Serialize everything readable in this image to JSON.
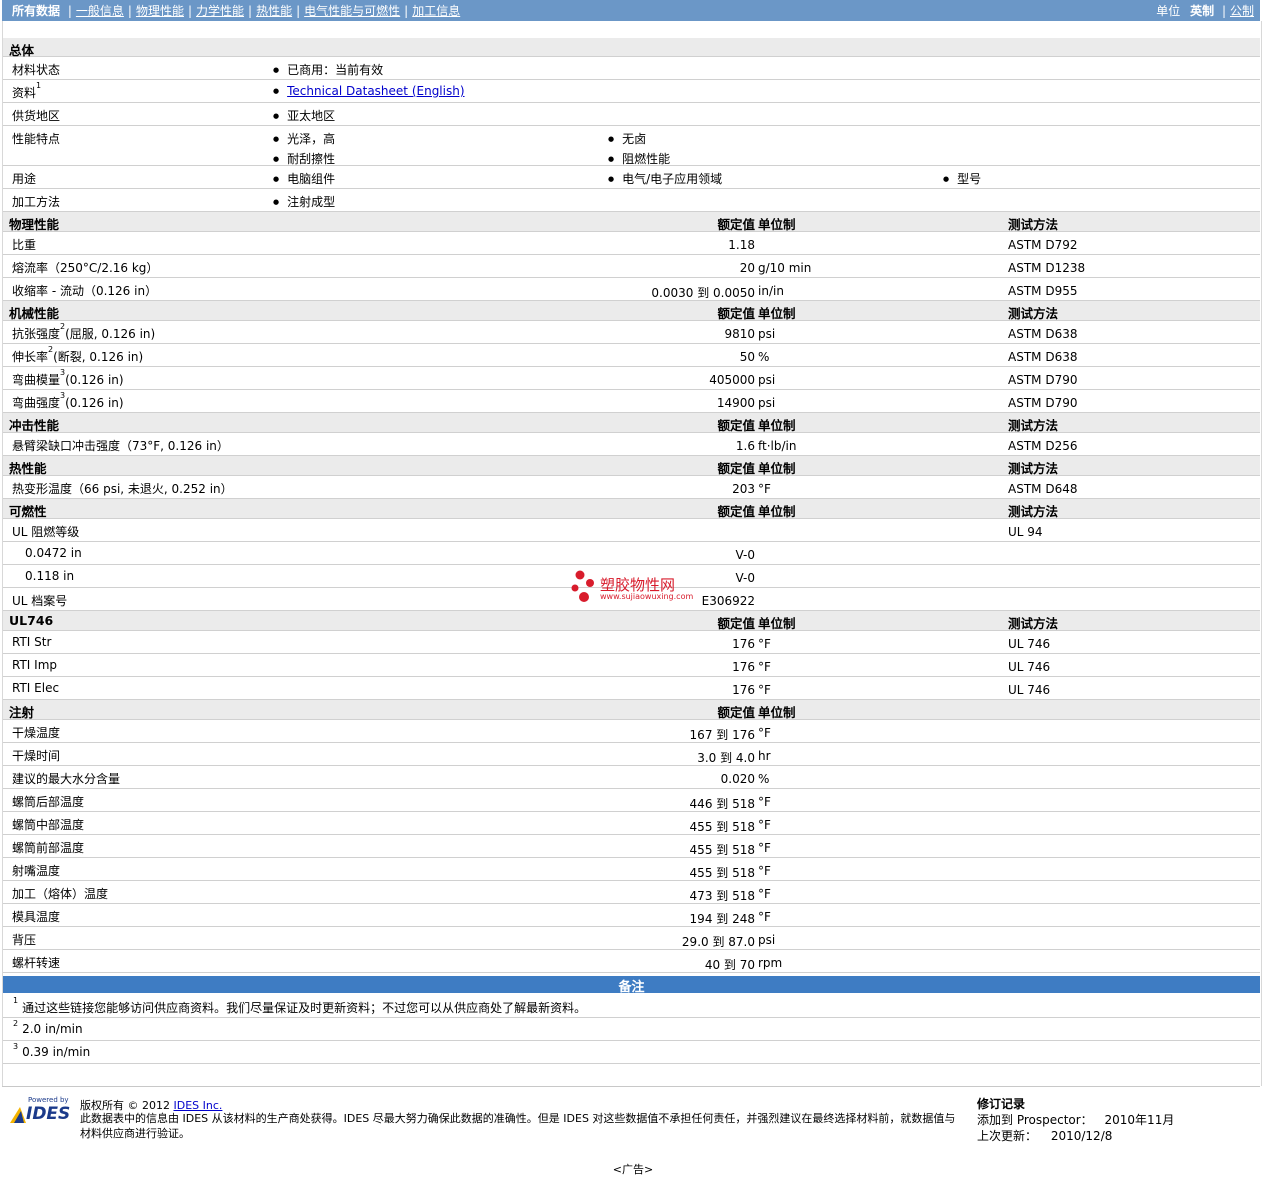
{
  "topnav": {
    "all_data": "所有数据",
    "tabs": [
      "一般信息",
      "物理性能",
      "力学性能",
      "热性能",
      "电气性能与可燃性",
      "加工信息"
    ],
    "unit_label": "单位",
    "unit_english": "英制",
    "unit_metric": "公制"
  },
  "general": {
    "title": "总体",
    "rows": [
      {
        "label": "材料状态",
        "items": [
          "已商用：当前有效"
        ]
      },
      {
        "label": "资料",
        "sup": "1",
        "link": "Technical Datasheet (English)"
      },
      {
        "label": "供货地区",
        "items": [
          "亚太地区"
        ]
      },
      {
        "label": "性能特点",
        "items": [
          "光泽，高",
          "无卤",
          "耐刮擦性",
          "阻燃性能"
        ]
      },
      {
        "label": "用途",
        "items": [
          "电脑组件",
          "电气/电子应用领域",
          "型号"
        ]
      },
      {
        "label": "加工方法",
        "items": [
          "注射成型"
        ]
      }
    ]
  },
  "columns": {
    "value": "额定值",
    "unit": "单位制",
    "test": "测试方法"
  },
  "sections": [
    {
      "title": "物理性能",
      "rows": [
        {
          "label": "比重",
          "value": "1.18",
          "unit": "",
          "test": "ASTM D792"
        },
        {
          "label": "熔流率（250°C/2.16 kg）",
          "value": "20",
          "unit": "g/10 min",
          "test": "ASTM D1238"
        },
        {
          "label": "收缩率 - 流动（0.126 in）",
          "value": "0.0030 到 0.0050",
          "unit": "in/in",
          "test": "ASTM D955"
        }
      ]
    },
    {
      "title": "机械性能",
      "rows": [
        {
          "label": "抗张强度",
          "sup": "2",
          "suffix": "(屈服, 0.126 in)",
          "value": "9810",
          "unit": "psi",
          "test": "ASTM D638"
        },
        {
          "label": "伸长率",
          "sup": "2",
          "suffix": "(断裂, 0.126 in)",
          "value": "50",
          "unit": "%",
          "test": "ASTM D638"
        },
        {
          "label": "弯曲模量",
          "sup": "3",
          "suffix": "(0.126 in)",
          "value": "405000",
          "unit": "psi",
          "test": "ASTM D790"
        },
        {
          "label": "弯曲强度",
          "sup": "3",
          "suffix": "(0.126 in)",
          "value": "14900",
          "unit": "psi",
          "test": "ASTM D790"
        }
      ]
    },
    {
      "title": "冲击性能",
      "rows": [
        {
          "label": "悬臂梁缺口冲击强度（73°F, 0.126 in）",
          "value": "1.6",
          "unit": "ft·lb/in",
          "test": "ASTM D256"
        }
      ]
    },
    {
      "title": "热性能",
      "rows": [
        {
          "label": "热变形温度（66 psi, 未退火, 0.252 in）",
          "value": "203",
          "unit": "°F",
          "test": "ASTM D648"
        }
      ]
    },
    {
      "title": "可燃性",
      "rows": [
        {
          "label": "UL 阻燃等级",
          "value": "",
          "unit": "",
          "test": "UL 94"
        },
        {
          "label": "0.0472 in",
          "indent": true,
          "value": "V-0",
          "unit": "",
          "test": ""
        },
        {
          "label": "0.118 in",
          "indent": true,
          "value": "V-0",
          "unit": "",
          "test": ""
        },
        {
          "label": "UL 档案号",
          "value": "E306922",
          "unit": "",
          "test": ""
        }
      ]
    },
    {
      "title": "UL746",
      "rows": [
        {
          "label": "RTI Str",
          "value": "176",
          "unit": "°F",
          "test": "UL 746"
        },
        {
          "label": "RTI Imp",
          "value": "176",
          "unit": "°F",
          "test": "UL 746"
        },
        {
          "label": "RTI Elec",
          "value": "176",
          "unit": "°F",
          "test": "UL 746"
        }
      ]
    },
    {
      "title": "注射",
      "notest": true,
      "rows": [
        {
          "label": "干燥温度",
          "value": "167 到  176",
          "unit": "°F",
          "test": ""
        },
        {
          "label": "干燥时间",
          "value": "3.0 到  4.0",
          "unit": "hr",
          "test": ""
        },
        {
          "label": "建议的最大水分含量",
          "value": "0.020",
          "unit": "%",
          "test": ""
        },
        {
          "label": "螺筒后部温度",
          "value": "446 到  518",
          "unit": "°F",
          "test": ""
        },
        {
          "label": "螺筒中部温度",
          "value": "455 到  518",
          "unit": "°F",
          "test": ""
        },
        {
          "label": "螺筒前部温度",
          "value": "455 到  518",
          "unit": "°F",
          "test": ""
        },
        {
          "label": "射嘴温度",
          "value": "455 到  518",
          "unit": "°F",
          "test": ""
        },
        {
          "label": "加工（熔体）温度",
          "value": "473 到  518",
          "unit": "°F",
          "test": ""
        },
        {
          "label": "模具温度",
          "value": "194 到  248",
          "unit": "°F",
          "test": ""
        },
        {
          "label": "背压",
          "value": "29.0 到  87.0",
          "unit": "psi",
          "test": ""
        },
        {
          "label": "螺杆转速",
          "value": "40 到  70",
          "unit": "rpm",
          "test": ""
        }
      ]
    }
  ],
  "notes": {
    "title": "备注",
    "items": [
      {
        "num": "1",
        "text": "通过这些链接您能够访问供应商资料。我们尽量保证及时更新资料；不过您可以从供应商处了解最新资料。"
      },
      {
        "num": "2",
        "text": "2.0 in/min"
      },
      {
        "num": "3",
        "text": "0.39 in/min"
      }
    ]
  },
  "watermark": {
    "text": "塑胶物性网",
    "sub": "www.sujiaowuxing.com"
  },
  "footer": {
    "logo_small": "Powered by",
    "logo": "IDES",
    "copyright": "版权所有 © 2012",
    "company_link": "IDES Inc.",
    "disclaimer": "此数据表中的信息由 IDES 从该材料的生产商处获得。IDES 尽最大努力确保此数据的准确性。但是 IDES 对这些数据值不承担任何责任，并强烈建议在最终选择材料前，就数据值与材料供应商进行验证。",
    "revision_title": "修订记录",
    "added_label": "添加到 Prospector：",
    "added_value": "2010年11月",
    "updated_label": "上次更新：",
    "updated_value": "2010/12/8",
    "ad": "<广告>"
  }
}
